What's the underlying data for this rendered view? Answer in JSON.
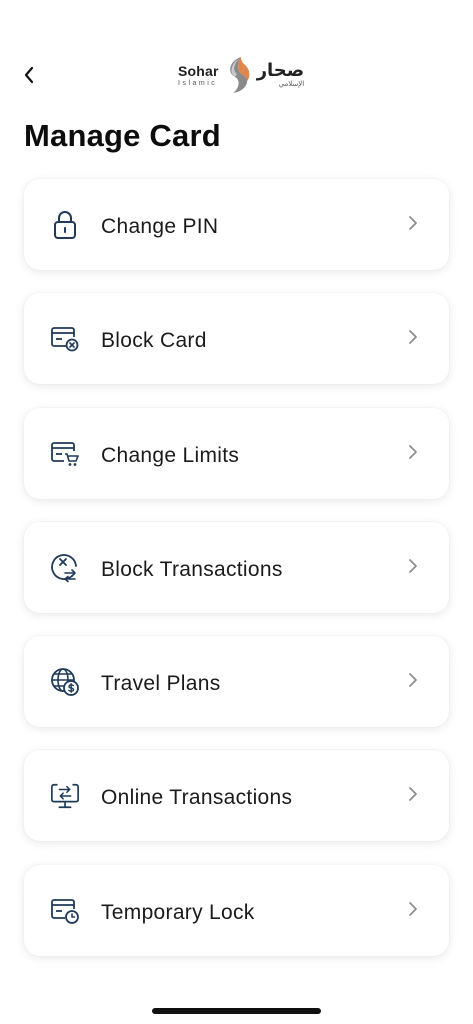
{
  "header": {
    "back_icon": "chevron-left-icon",
    "logo": {
      "en_name": "Sohar",
      "en_sub": "Islamic",
      "ar_name": "صحار",
      "ar_sub": "الإسلامي"
    }
  },
  "page": {
    "title": "Manage Card"
  },
  "colors": {
    "icon": "#1f3a5a",
    "chevron": "#8e8e93",
    "title": "#0d0d0d",
    "logo_orange": "#e0854b",
    "logo_gray": "#8a8a8a"
  },
  "menu": {
    "items": [
      {
        "label": "Change PIN",
        "icon": "lock-icon"
      },
      {
        "label": "Block Card",
        "icon": "card-block-icon"
      },
      {
        "label": "Change Limits",
        "icon": "card-cart-icon"
      },
      {
        "label": "Block Transactions",
        "icon": "block-transactions-icon"
      },
      {
        "label": "Travel Plans",
        "icon": "globe-dollar-icon"
      },
      {
        "label": "Online Transactions",
        "icon": "monitor-transfer-icon"
      },
      {
        "label": "Temporary Lock",
        "icon": "card-clock-icon"
      }
    ]
  }
}
